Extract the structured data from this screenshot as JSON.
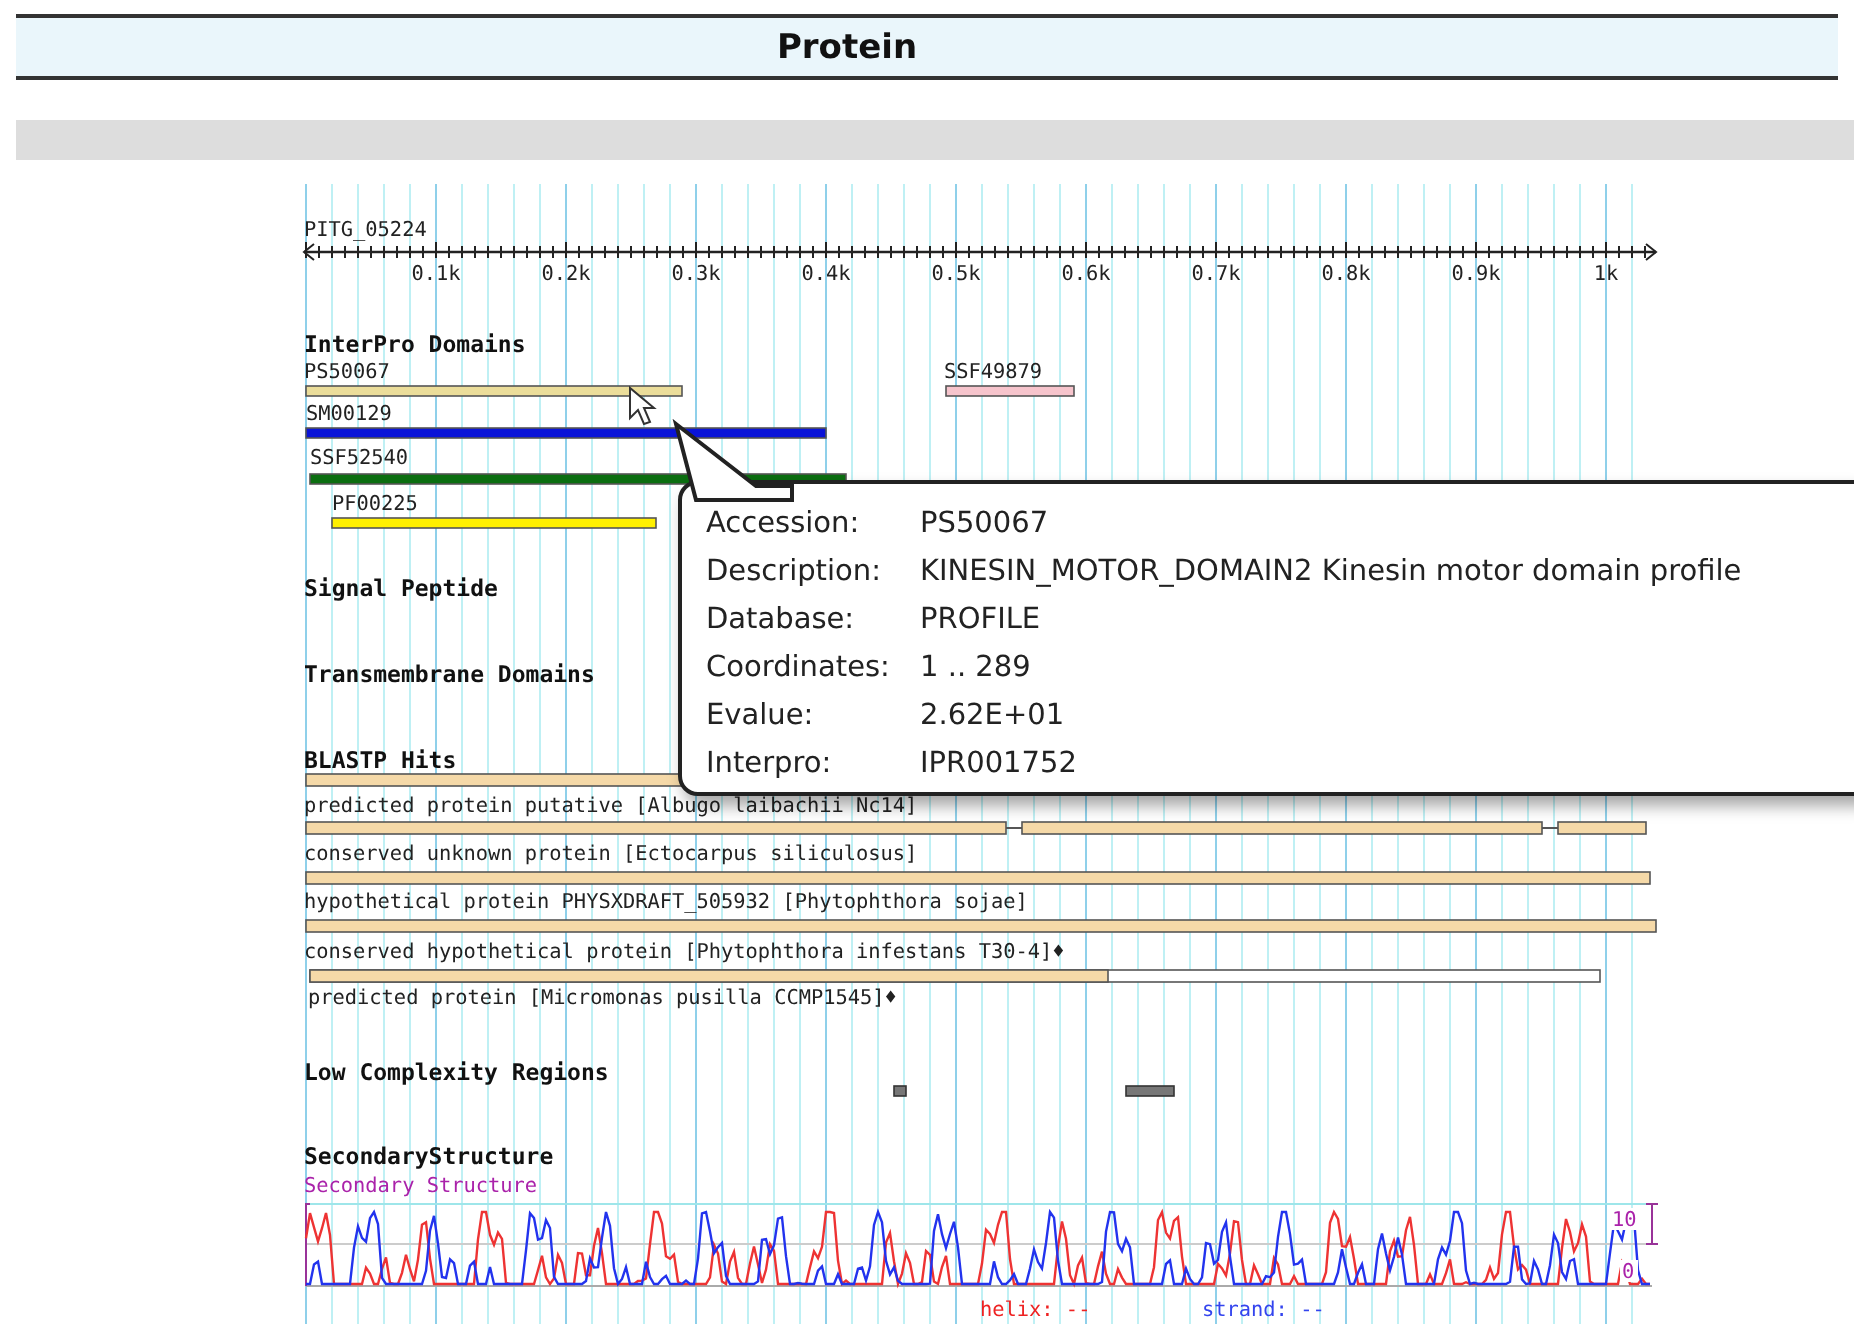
{
  "page_title": "Protein",
  "sequence_id": "PITG_05224",
  "axis_labels": [
    "0.1k",
    "0.2k",
    "0.3k",
    "0.4k",
    "0.5k",
    "0.6k",
    "0.7k",
    "0.8k",
    "0.9k",
    "1k"
  ],
  "interpro": {
    "title": "InterPro Domains",
    "domains": [
      {
        "label": "PS50067",
        "color": "#ebdd9a"
      },
      {
        "label": "SSF49879",
        "color": "#f6c4cc"
      },
      {
        "label": "SM00129",
        "color": "#0a14d8"
      },
      {
        "label": "SSF52540",
        "color": "#0b6e10"
      },
      {
        "label": "PF00225",
        "color": "#fff000"
      }
    ]
  },
  "signal_peptide": {
    "title": "Signal Peptide"
  },
  "transmembrane": {
    "title": "Transmembrane Domains"
  },
  "blastp": {
    "title": "BLASTP Hits",
    "hits": [
      {
        "label": "predicted protein putative [Albugo laibachii Nc14]"
      },
      {
        "label": "conserved unknown protein [Ectocarpus siliculosus]"
      },
      {
        "label": "hypothetical protein PHYSXDRAFT_505932 [Phytophthora sojae]"
      },
      {
        "label": "conserved hypothetical protein [Phytophthora infestans T30-4]♦"
      },
      {
        "label": "predicted protein [Micromonas pusilla CCMP1545]♦"
      }
    ]
  },
  "low_complexity": {
    "title": "Low Complexity Regions"
  },
  "secondary_structure": {
    "title": "SecondaryStructure",
    "subtitle": "Secondary Structure",
    "max_label": "10",
    "min_label": "0",
    "legend": [
      {
        "label": "helix: --",
        "color": "#ee2222"
      },
      {
        "label": "strand: --",
        "color": "#3344ee"
      }
    ]
  },
  "tooltip": {
    "rows": [
      {
        "label": "Accession:",
        "value": "PS50067"
      },
      {
        "label": "Description:",
        "value": "KINESIN_MOTOR_DOMAIN2 Kinesin motor domain profile"
      },
      {
        "label": "Database:",
        "value": "PROFILE"
      },
      {
        "label": "Coordinates:",
        "value": "1 .. 289"
      },
      {
        "label": "Evalue:",
        "value": "2.62E+01"
      },
      {
        "label": "Interpro:",
        "value": "IPR001752"
      }
    ]
  }
}
